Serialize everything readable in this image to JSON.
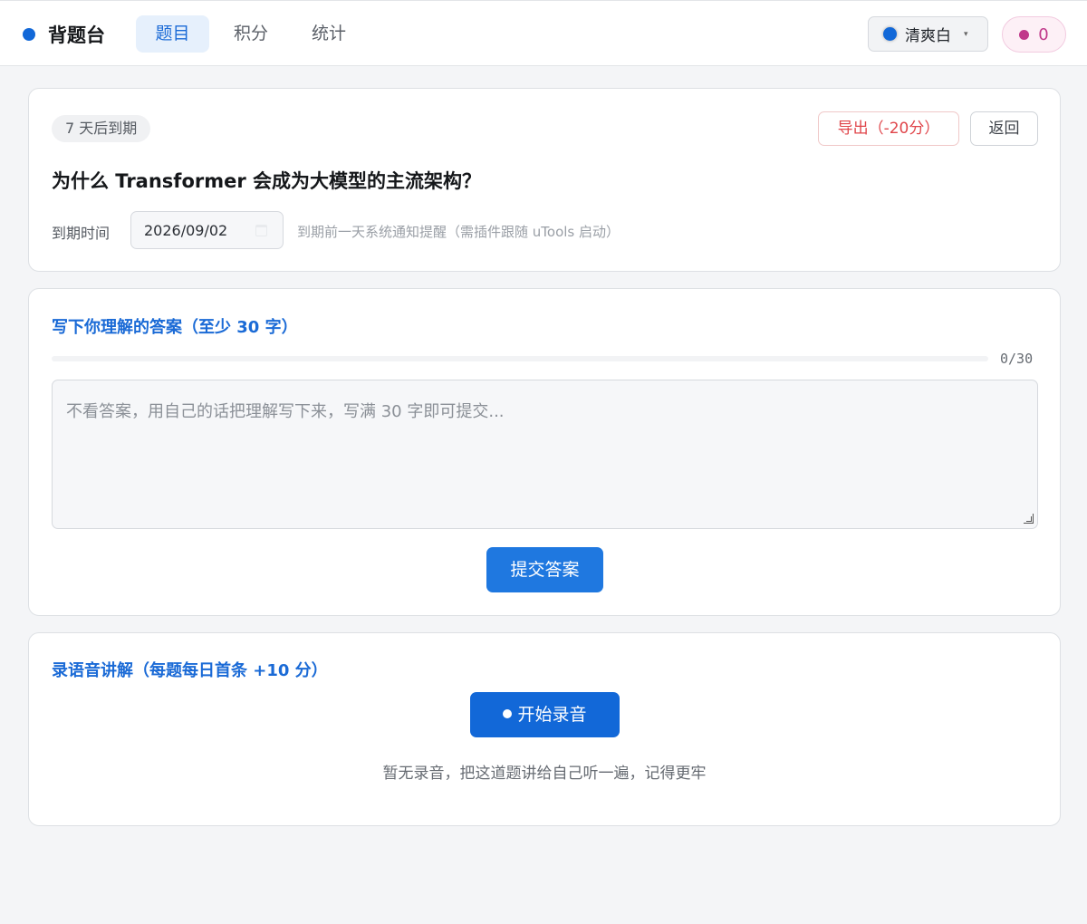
{
  "app": {
    "name": "背题台"
  },
  "nav": {
    "tabs": [
      {
        "label": "题目",
        "active": true
      },
      {
        "label": "积分",
        "active": false
      },
      {
        "label": "统计",
        "active": false
      }
    ]
  },
  "theme": {
    "selected": "清爽白",
    "caret": "▾"
  },
  "points": {
    "value": "0"
  },
  "question": {
    "due_badge": "7 天后到期",
    "export_label": "导出（-20分）",
    "back_label": "返回",
    "title": "为什么 Transformer 会成为大模型的主流架构？",
    "due_label": "到期时间",
    "due_date": "2026/09/02",
    "due_hint": "到期前一天系统通知提醒（需插件跟随 uTools 启动）"
  },
  "answer": {
    "title": "写下你理解的答案（至少 30 字）",
    "progress_count": "0/30",
    "progress": 0,
    "placeholder": "不看答案，用自己的话把理解写下来，写满 30 字即可提交...",
    "value": "",
    "submit_label": "提交答案"
  },
  "voice": {
    "title": "录语音讲解（每题每日首条 +10 分）",
    "record_label": "开始录音",
    "empty_hint": "暂无录音，把这道题讲给自己听一遍，记得更牢"
  },
  "colors": {
    "accent": "#1268d8",
    "primary_button": "#1f78e0",
    "points": "#c0398a",
    "danger": "#e0454a"
  }
}
